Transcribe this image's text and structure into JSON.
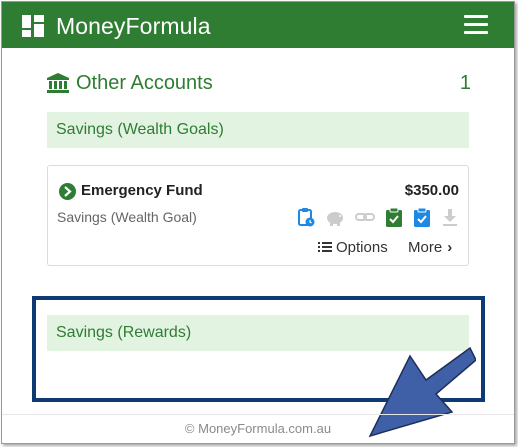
{
  "app": {
    "brand": "MoneyFormula"
  },
  "section": {
    "title": "Other Accounts",
    "count": "1"
  },
  "groups": [
    {
      "label": "Savings (Wealth Goals)"
    },
    {
      "label": "Savings (Rewards)"
    }
  ],
  "account": {
    "name": "Emergency Fund",
    "amount": "$350.00",
    "type": "Savings (Wealth Goal)",
    "tools": [
      "clipboard-clock-icon",
      "piggy-bank-icon",
      "link-icon",
      "clipboard-check-green-icon",
      "clipboard-check-blue-icon",
      "download-icon"
    ],
    "options_label": "Options",
    "more_label": "More"
  },
  "footer": {
    "text": "© MoneyFormula.com.au"
  },
  "colors": {
    "brand_green": "#2e7d32",
    "group_bg": "#e3f3e2",
    "highlight": "#0d3a73",
    "arrow": "#3f5fa6"
  }
}
